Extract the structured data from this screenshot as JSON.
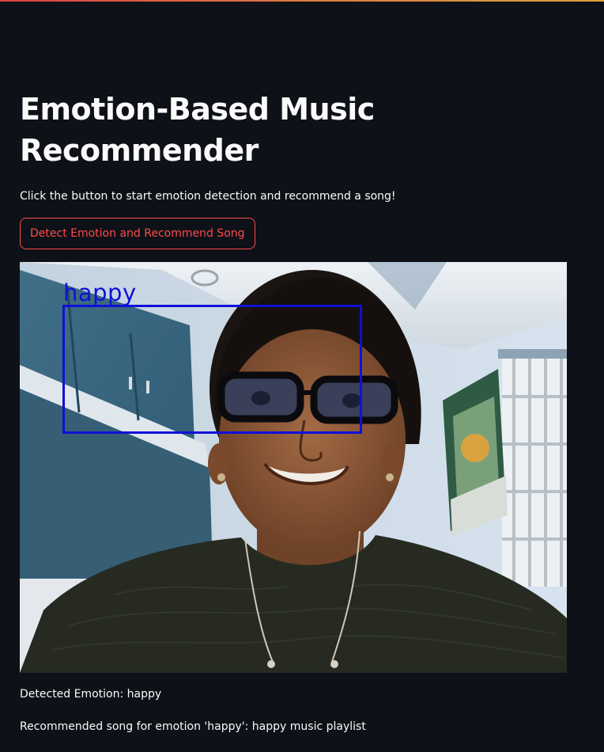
{
  "app": {
    "title": "Emotion-Based Music Recommender",
    "caption": "Click the button to start emotion detection and recommend a song!",
    "detect_button_label": "Detect Emotion and Recommend Song"
  },
  "webcam_frame": {
    "face_label": "happy",
    "box_color": "#1010d8"
  },
  "results": {
    "detected_emotion": "Detected Emotion: happy",
    "recommendation": "Recommended song for emotion 'happy': happy music playlist"
  },
  "colors": {
    "background": "#0e1117",
    "text": "#fafafa",
    "accent": "#ff4b4b"
  }
}
